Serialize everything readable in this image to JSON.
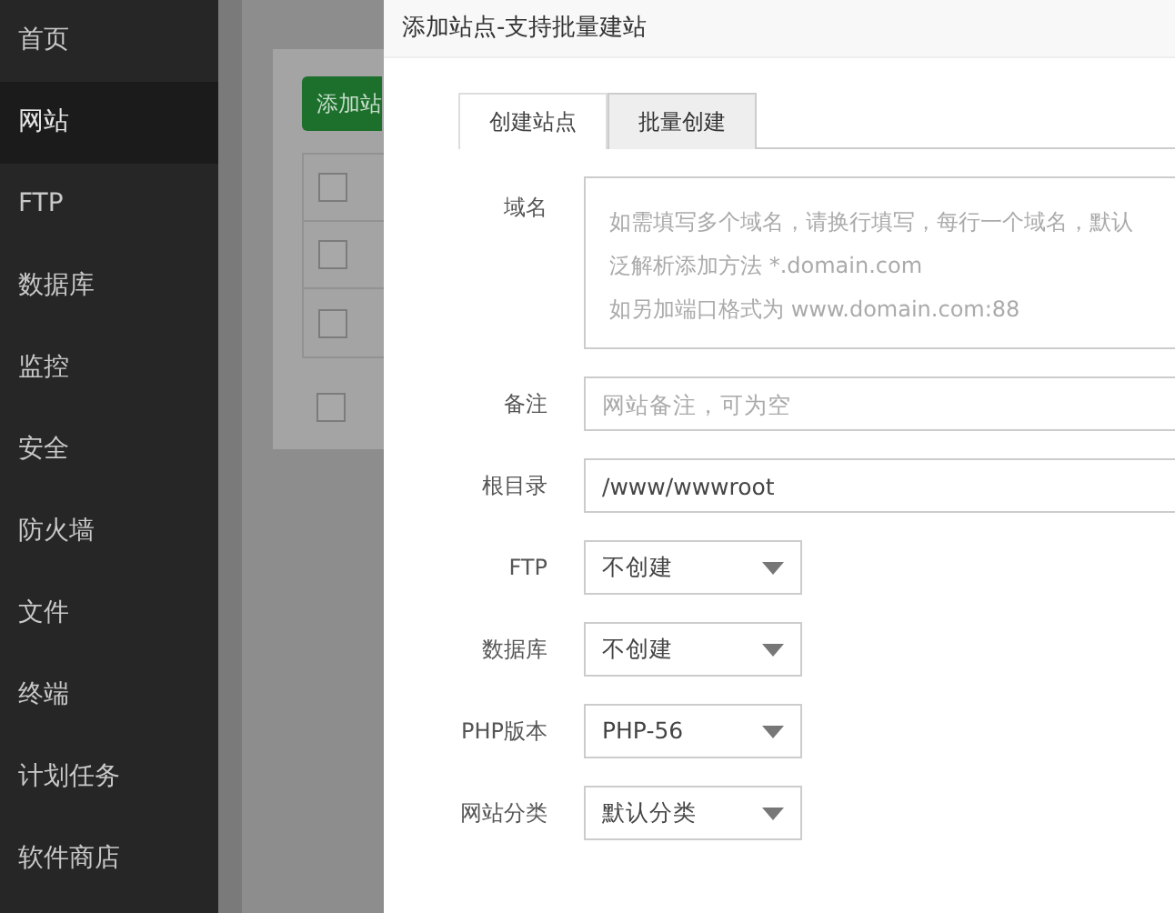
{
  "sidebar": {
    "items": [
      {
        "label": "首页",
        "selected": false
      },
      {
        "label": "网站",
        "selected": true
      },
      {
        "label": "FTP",
        "selected": false
      },
      {
        "label": "数据库",
        "selected": false
      },
      {
        "label": "监控",
        "selected": false
      },
      {
        "label": "安全",
        "selected": false
      },
      {
        "label": "防火墙",
        "selected": false
      },
      {
        "label": "文件",
        "selected": false
      },
      {
        "label": "终端",
        "selected": false
      },
      {
        "label": "计划任务",
        "selected": false
      },
      {
        "label": "软件商店",
        "selected": false
      }
    ]
  },
  "background_panel": {
    "button": "添加站",
    "rows": [
      {
        "checked": false
      },
      {
        "checked": false
      },
      {
        "checked": false
      }
    ],
    "footer_checkbox": {
      "checked": false
    }
  },
  "dialog": {
    "title": "添加站点-支持批量建站",
    "tabs": [
      {
        "label": "创建站点",
        "selected": true
      },
      {
        "label": "批量创建",
        "selected": false
      }
    ],
    "fields": [
      {
        "kind": "textarea",
        "label": "域名",
        "placeholder_lines": [
          "如需填写多个域名，请换行填写，每行一个域名，默认",
          "泛解析添加方法 *.domain.com",
          "如另加端口格式为 www.domain.com:88"
        ]
      },
      {
        "kind": "input",
        "label": "备注",
        "placeholder": "网站备注，可为空"
      },
      {
        "kind": "input",
        "label": "根目录",
        "value": "/www/wwwroot"
      },
      {
        "kind": "select",
        "label": "FTP",
        "value": "不创建"
      },
      {
        "kind": "select",
        "label": "数据库",
        "value": "不创建"
      },
      {
        "kind": "select",
        "label": "PHP版本",
        "value": "PHP-56"
      },
      {
        "kind": "select",
        "label": "网站分类",
        "value": "默认分类"
      }
    ]
  }
}
